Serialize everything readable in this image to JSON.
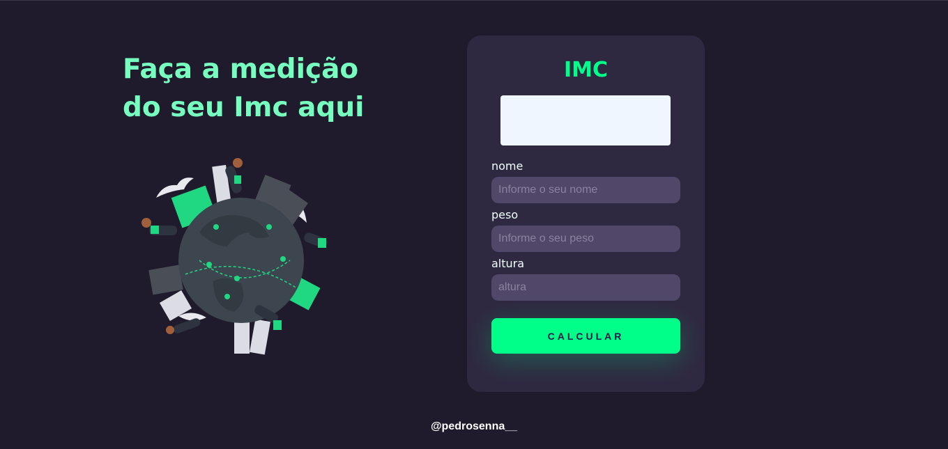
{
  "hero": {
    "title": "Faça a medição do seu Imc aqui"
  },
  "card": {
    "title": "IMC",
    "result": "",
    "fields": [
      {
        "label": "nome",
        "placeholder": "Informe o seu nome"
      },
      {
        "label": "peso",
        "placeholder": "Informe o seu peso"
      },
      {
        "label": "altura",
        "placeholder": "altura"
      }
    ],
    "button_label": "CALCULAR"
  },
  "footer": {
    "text": "@pedrosenna__"
  },
  "colors": {
    "background": "#201b2c",
    "accent": "#00ff88",
    "headline": "#77ffc0",
    "card": "#2f2841",
    "input": "#514869"
  },
  "icons": [
    "globe-illustration",
    "location-pin-icon"
  ]
}
